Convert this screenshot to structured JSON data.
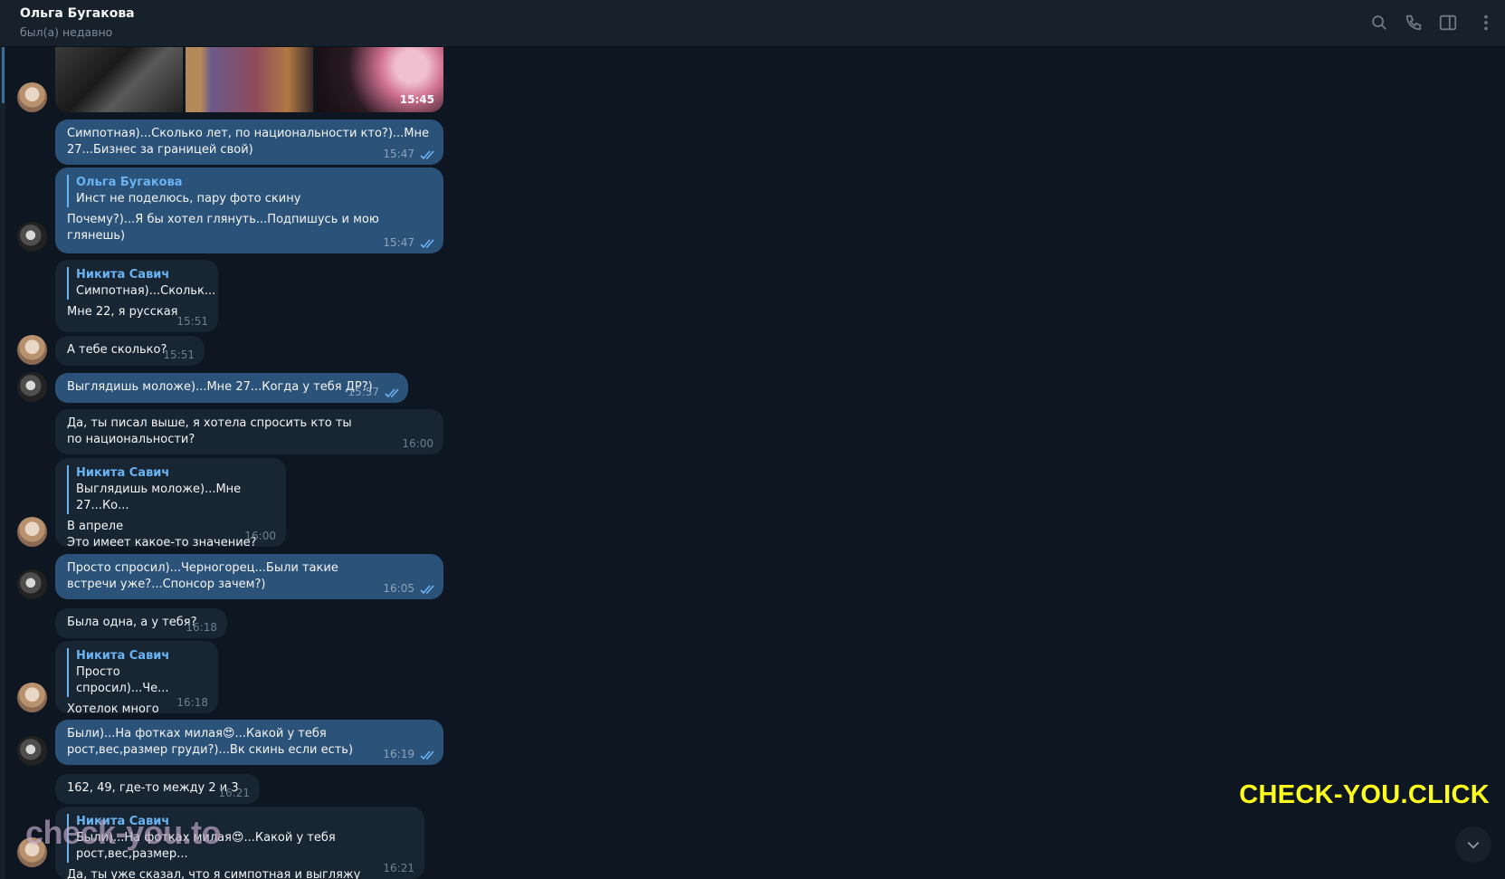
{
  "header": {
    "contact_name": "Ольга Бугакова",
    "status": "был(а) недавно",
    "icons": [
      "search-icon",
      "phone-icon",
      "sidebar-toggle-icon",
      "more-vertical-icon"
    ]
  },
  "colors": {
    "background": "#0e1621",
    "header": "#17212b",
    "incoming_bubble": "#182533",
    "outgoing_bubble": "#2b5278",
    "reply_accent": "#6ab3f3",
    "watermark_primary": "#ffff1a"
  },
  "album": {
    "time": "15:45"
  },
  "messages": [
    {
      "dir": "out",
      "text": "Симпотная)...Сколько лет, по национальности кто?)...Мне 27...Бизнес за границей свой)",
      "time": "15:47"
    },
    {
      "dir": "out",
      "reply_name": "Ольга Бугакова",
      "reply_text": "Инст не поделюсь, пару фото скину",
      "text": "Почему?)...Я бы хотел глянуть...Подпишусь и мою глянешь)",
      "time": "15:47"
    },
    {
      "dir": "in",
      "reply_name": "Никита Савич",
      "reply_text": "Симпотная)...Скольк...",
      "text": "Мне 22, я русская",
      "time": "15:51"
    },
    {
      "dir": "in",
      "text": "А тебе сколько?",
      "time": "15:51"
    },
    {
      "dir": "out",
      "text": "Выглядишь моложе)...Мне 27...Когда у тебя ДР?)",
      "time": "15:57"
    },
    {
      "dir": "in",
      "text": "Да, ты писал выше, я хотела спросить кто ты по национальности?",
      "time": "16:00"
    },
    {
      "dir": "in",
      "reply_name": "Никита Савич",
      "reply_text": "Выглядишь моложе)...Мне 27...Ко...",
      "text": "В апреле\nЭто имеет какое-то значение?",
      "time": "16:00"
    },
    {
      "dir": "out",
      "text": "Просто спросил)...Черногорец...Были такие встречи уже?...Спонсор зачем?)",
      "time": "16:05"
    },
    {
      "dir": "in",
      "text": "Была одна, а у тебя?",
      "time": "16:18"
    },
    {
      "dir": "in",
      "reply_name": "Никита Савич",
      "reply_text": "Просто спросил)...Че...",
      "text": "Хотелок много",
      "time": "16:18"
    },
    {
      "dir": "out",
      "text": "Были)...На фотках милая😍...Какой у тебя рост,вес,размер груди?)...Вк скинь если есть)",
      "time": "16:19"
    },
    {
      "dir": "in",
      "text": "162, 49, где-то между 2 и 3",
      "time": "16:21"
    },
    {
      "dir": "in",
      "reply_name": "Никита Савич",
      "reply_text": "Были)...На фотках милая😍...Какой у тебя рост,вес,размер...",
      "text": "Да, ты уже сказал, что я симпотная и выгляжу моложе)",
      "time": "16:21"
    }
  ],
  "watermarks": {
    "primary": "CHECK-YOU.CLICK",
    "secondary": "check-you.to"
  }
}
